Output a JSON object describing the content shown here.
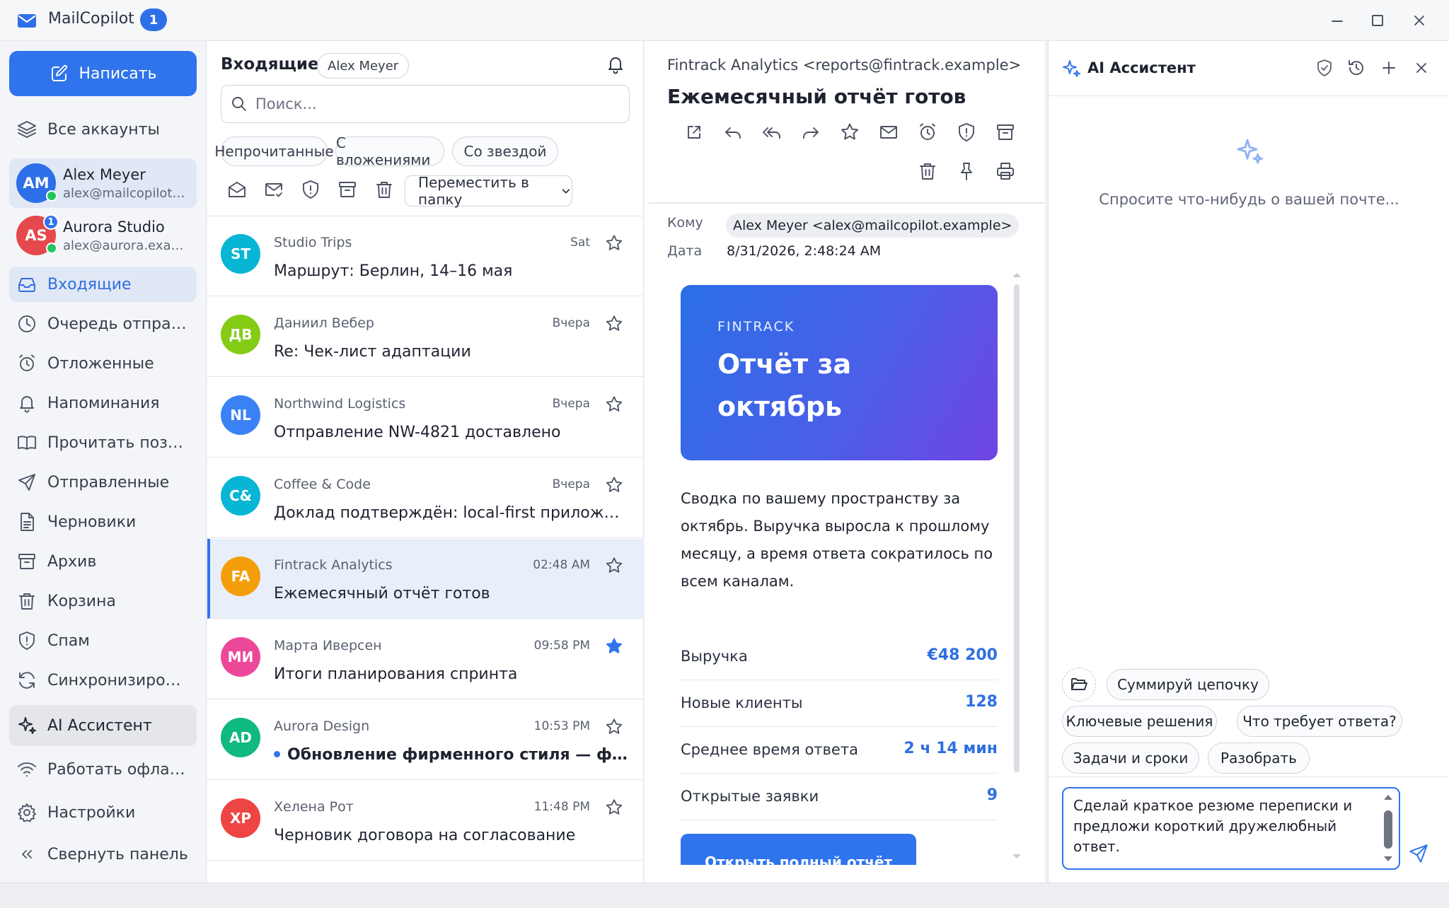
{
  "app": {
    "title": "MailCopilot",
    "badge": "1"
  },
  "sidebar": {
    "compose_label": "Написать",
    "all_accounts": "Все аккаунты",
    "accounts": [
      {
        "initials": "AM",
        "name": "Alex Meyer",
        "email": "alex@mailcopilot.example",
        "color": "#2d6fe8",
        "status": "online"
      },
      {
        "initials": "AS",
        "name": "Aurora Studio",
        "email": "alex@aurora.example",
        "color": "#e5484d",
        "count": "1",
        "status": "online"
      }
    ],
    "items": [
      {
        "label": "Входящие",
        "icon": "inbox-icon"
      },
      {
        "label": "Очередь отправки",
        "icon": "clock-icon"
      },
      {
        "label": "Отложенные",
        "icon": "alarm-clock-icon"
      },
      {
        "label": "Напоминания",
        "icon": "bell-icon"
      },
      {
        "label": "Прочитать позже",
        "icon": "book-icon"
      },
      {
        "label": "Отправленные",
        "icon": "send-icon"
      },
      {
        "label": "Черновики",
        "icon": "file-icon"
      },
      {
        "label": "Архив",
        "icon": "archive-icon"
      },
      {
        "label": "Корзина",
        "icon": "trash-icon"
      },
      {
        "label": "Спам",
        "icon": "shield-icon"
      },
      {
        "label": "Синхронизировать",
        "icon": "sync-icon"
      },
      {
        "label": "AI Ассистент",
        "icon": "sparkles-icon"
      },
      {
        "label": "Работать офлайн",
        "icon": "wifi-icon"
      },
      {
        "label": "Настройки",
        "icon": "gear-icon"
      },
      {
        "label": "Свернуть панель",
        "icon": "chevrons-left-icon"
      }
    ]
  },
  "list": {
    "title": "Входящие",
    "account_chip": "Alex Meyer",
    "search_placeholder": "Поиск...",
    "filters": [
      "Непрочитанные",
      "С вложениями",
      "Со звездой"
    ],
    "move_label": "Переместить в папку",
    "messages": [
      {
        "initials": "ST",
        "color": "#06b6d4",
        "sender": "Studio Trips",
        "time": "Sat",
        "subject": "Маршрут: Берлин, 14–16 мая",
        "starred": false,
        "unread": false,
        "selected": false
      },
      {
        "initials": "ДВ",
        "color": "#84cc16",
        "sender": "Даниил Вебер",
        "time": "Вчера",
        "subject": "Re: Чек-лист адаптации",
        "starred": false,
        "unread": false,
        "selected": false
      },
      {
        "initials": "NL",
        "color": "#3b82f6",
        "sender": "Northwind Logistics",
        "time": "Вчера",
        "subject": "Отправление NW-4821 доставлено",
        "starred": false,
        "unread": false,
        "selected": false
      },
      {
        "initials": "C&",
        "color": "#06b6d4",
        "sender": "Coffee & Code",
        "time": "Вчера",
        "subject": "Доклад подтверждён: local-first приложения",
        "starred": false,
        "unread": false,
        "selected": false
      },
      {
        "initials": "FA",
        "color": "#f59e0b",
        "sender": "Fintrack Analytics",
        "time": "02:48 AM",
        "subject": "Ежемесячный отчёт готов",
        "starred": false,
        "unread": false,
        "selected": true
      },
      {
        "initials": "МИ",
        "color": "#ec4899",
        "sender": "Марта Иверсен",
        "time": "09:58 PM",
        "subject": "Итоги планирования спринта",
        "starred": true,
        "unread": false,
        "selected": false
      },
      {
        "initials": "AD",
        "color": "#10b981",
        "sender": "Aurora Design",
        "time": "10:53 PM",
        "subject": "Обновление фирменного стиля — финальная версия",
        "starred": false,
        "unread": true,
        "selected": false
      },
      {
        "initials": "ХР",
        "color": "#ef4444",
        "sender": "Хелена Рот",
        "time": "11:48 PM",
        "subject": "Черновик договора на согласование",
        "starred": false,
        "unread": false,
        "selected": false
      }
    ]
  },
  "reader": {
    "from": "Fintrack Analytics <reports@fintrack.example>",
    "subject": "Ежемесячный отчёт готов",
    "to_label": "Кому",
    "to_value": "Alex Meyer <alex@mailcopilot.example>",
    "date_label": "Дата",
    "date_value": "8/31/2026, 2:48:24 AM",
    "hero_brand": "FINTRACK",
    "hero_title": "Отчёт за октябрь",
    "summary": "Сводка по вашему пространству за октябрь. Выручка выросла к прошлому месяцу, а время ответа сократилось по всем каналам.",
    "stats": [
      {
        "label": "Выручка",
        "value": "€48 200"
      },
      {
        "label": "Новые клиенты",
        "value": "128"
      },
      {
        "label": "Среднее время ответа",
        "value": "2 ч 14 мин"
      },
      {
        "label": "Открытые заявки",
        "value": "9"
      }
    ],
    "cta": "Открыть полный отчёт"
  },
  "ai": {
    "title": "AI Ассистент",
    "empty_text": "Спросите что-нибудь о вашей почте...",
    "suggestions": [
      "Суммируй цепочку",
      "Ключевые решения",
      "Что требует ответа?",
      "Задачи и сроки",
      "Разобрать"
    ],
    "input_value": "Сделай краткое резюме переписки и предложи короткий дружелюбный ответ."
  }
}
